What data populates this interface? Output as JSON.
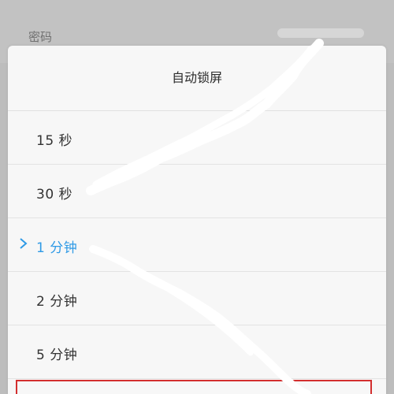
{
  "background": {
    "row_label": "密码"
  },
  "dialog": {
    "title": "自动锁屏",
    "options": [
      {
        "label": "15 秒",
        "selected": false
      },
      {
        "label": "30 秒",
        "selected": false
      },
      {
        "label": "1 分钟",
        "selected": true
      },
      {
        "label": "2 分钟",
        "selected": false
      },
      {
        "label": "5 分钟",
        "selected": false
      }
    ]
  },
  "colors": {
    "accent": "#2f9ae6",
    "highlight": "#d32f2f",
    "dialog_bg": "#f7f7f7",
    "backdrop": "#bdbdbd"
  },
  "icons": {
    "selected_marker": "chevron-right-icon"
  }
}
